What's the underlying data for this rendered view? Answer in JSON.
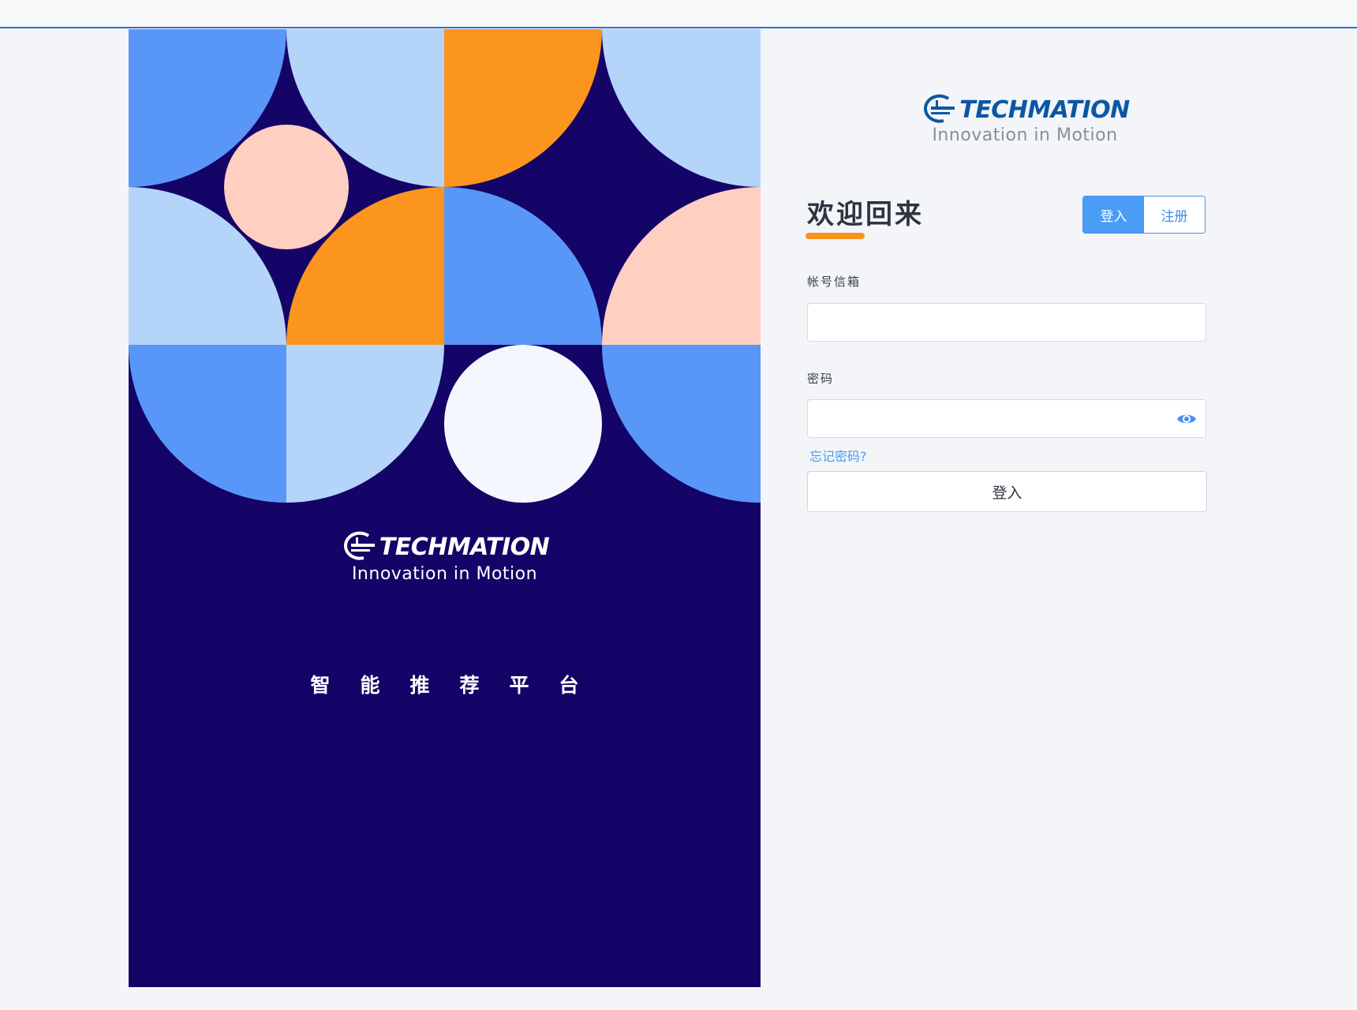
{
  "brand": {
    "name": "TECHMATION",
    "tagline": "Innovation in Motion"
  },
  "left": {
    "platform_title": "智能推荐平台"
  },
  "login": {
    "welcome": "欢迎回来",
    "tabs": [
      {
        "label": "登入",
        "active": true
      },
      {
        "label": "注册",
        "active": false
      }
    ],
    "account_label": "帐号信箱",
    "account_value": "",
    "password_label": "密码",
    "password_value": "",
    "forgot_link": "忘记密码?",
    "submit_label": "登入"
  },
  "icons": {
    "password_toggle": "eye-icon",
    "logo": "techmation-logo-icon"
  },
  "colors": {
    "panel_background": "#150467",
    "accent_blue": "#4a9cf5",
    "accent_orange": "#f7931e",
    "logo_blue": "#0b57a5"
  }
}
